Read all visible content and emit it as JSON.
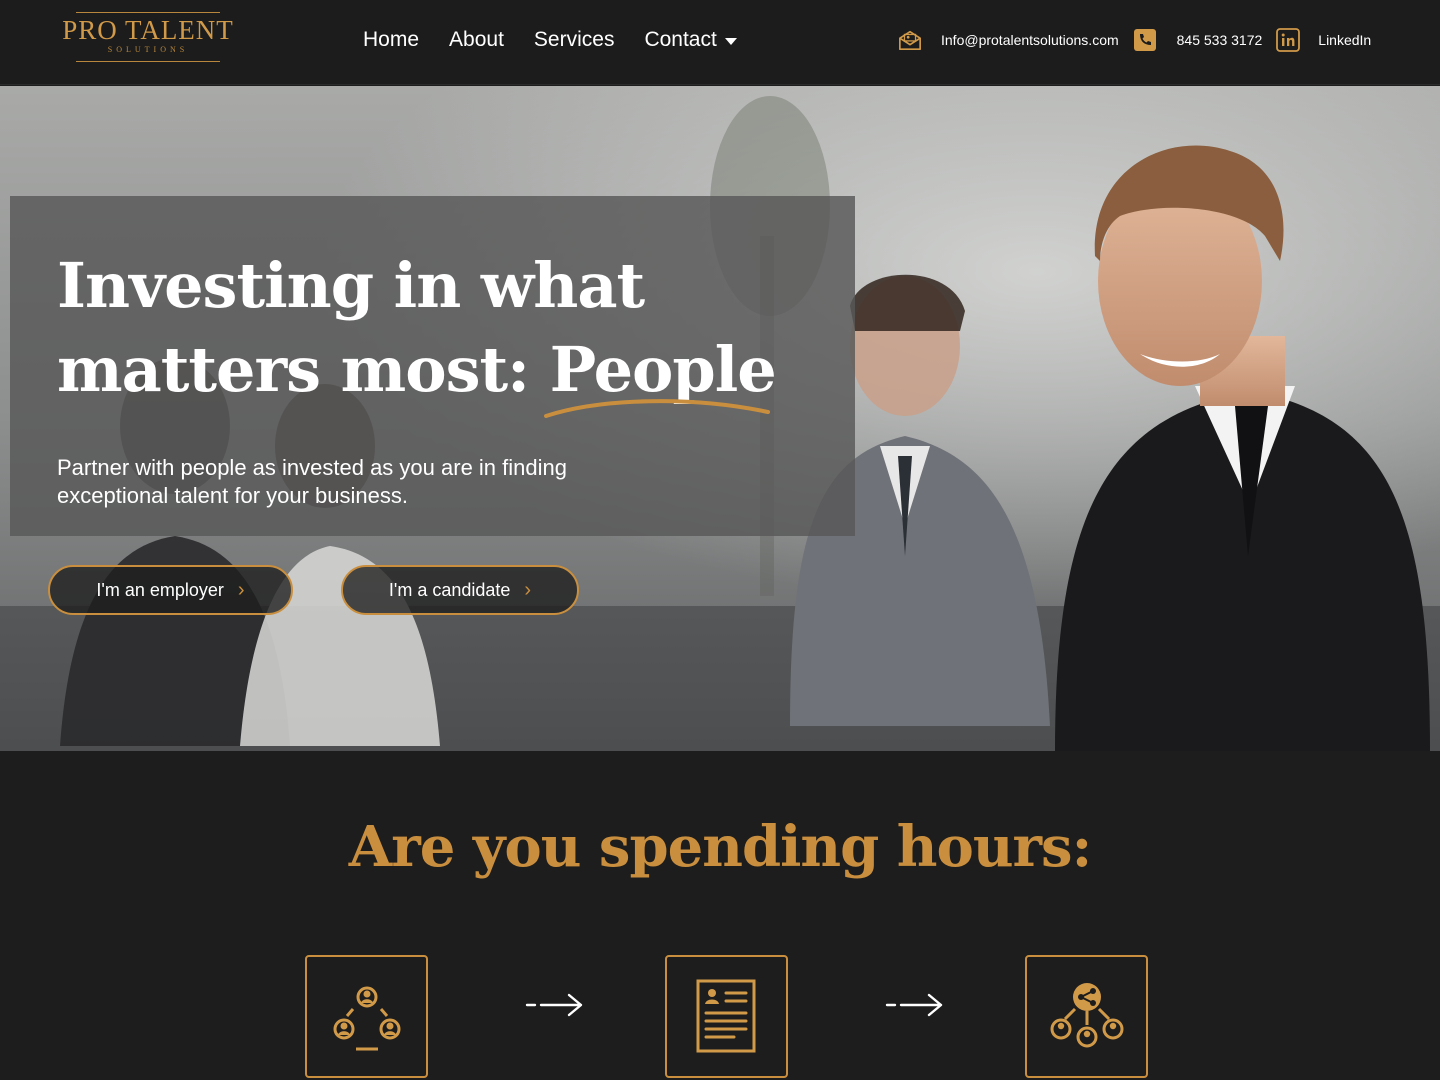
{
  "brand": {
    "name": "PRO TALENT",
    "tagline": "SOLUTIONS"
  },
  "nav": {
    "items": [
      {
        "label": "Home"
      },
      {
        "label": "About"
      },
      {
        "label": "Services"
      },
      {
        "label": "Contact",
        "has_dropdown": true
      }
    ]
  },
  "contact": {
    "email": "Info@protalentsolutions.com",
    "phone": "845 533 3172",
    "linkedin": "LinkedIn",
    "icons": [
      "email-icon",
      "phone-icon",
      "linkedin-icon"
    ]
  },
  "hero": {
    "title_line1": "Investing in what",
    "title_line2_prefix": "matters most: ",
    "title_highlight": "People",
    "subtitle": "Partner with people as invested as you are in finding exceptional talent for your business.",
    "buttons": [
      {
        "label": "I'm an employer"
      },
      {
        "label": "I'm a candidate"
      }
    ]
  },
  "section": {
    "title": "Are you spending hours:",
    "steps": [
      {
        "icon": "people-network-icon"
      },
      {
        "icon": "resume-document-icon"
      },
      {
        "icon": "share-network-icon"
      }
    ],
    "arrow_icon": "arrow-right-icon"
  },
  "colors": {
    "accent": "#c98f3e",
    "header_bg": "#1c1c1c",
    "section_bg": "#1e1d1d"
  }
}
